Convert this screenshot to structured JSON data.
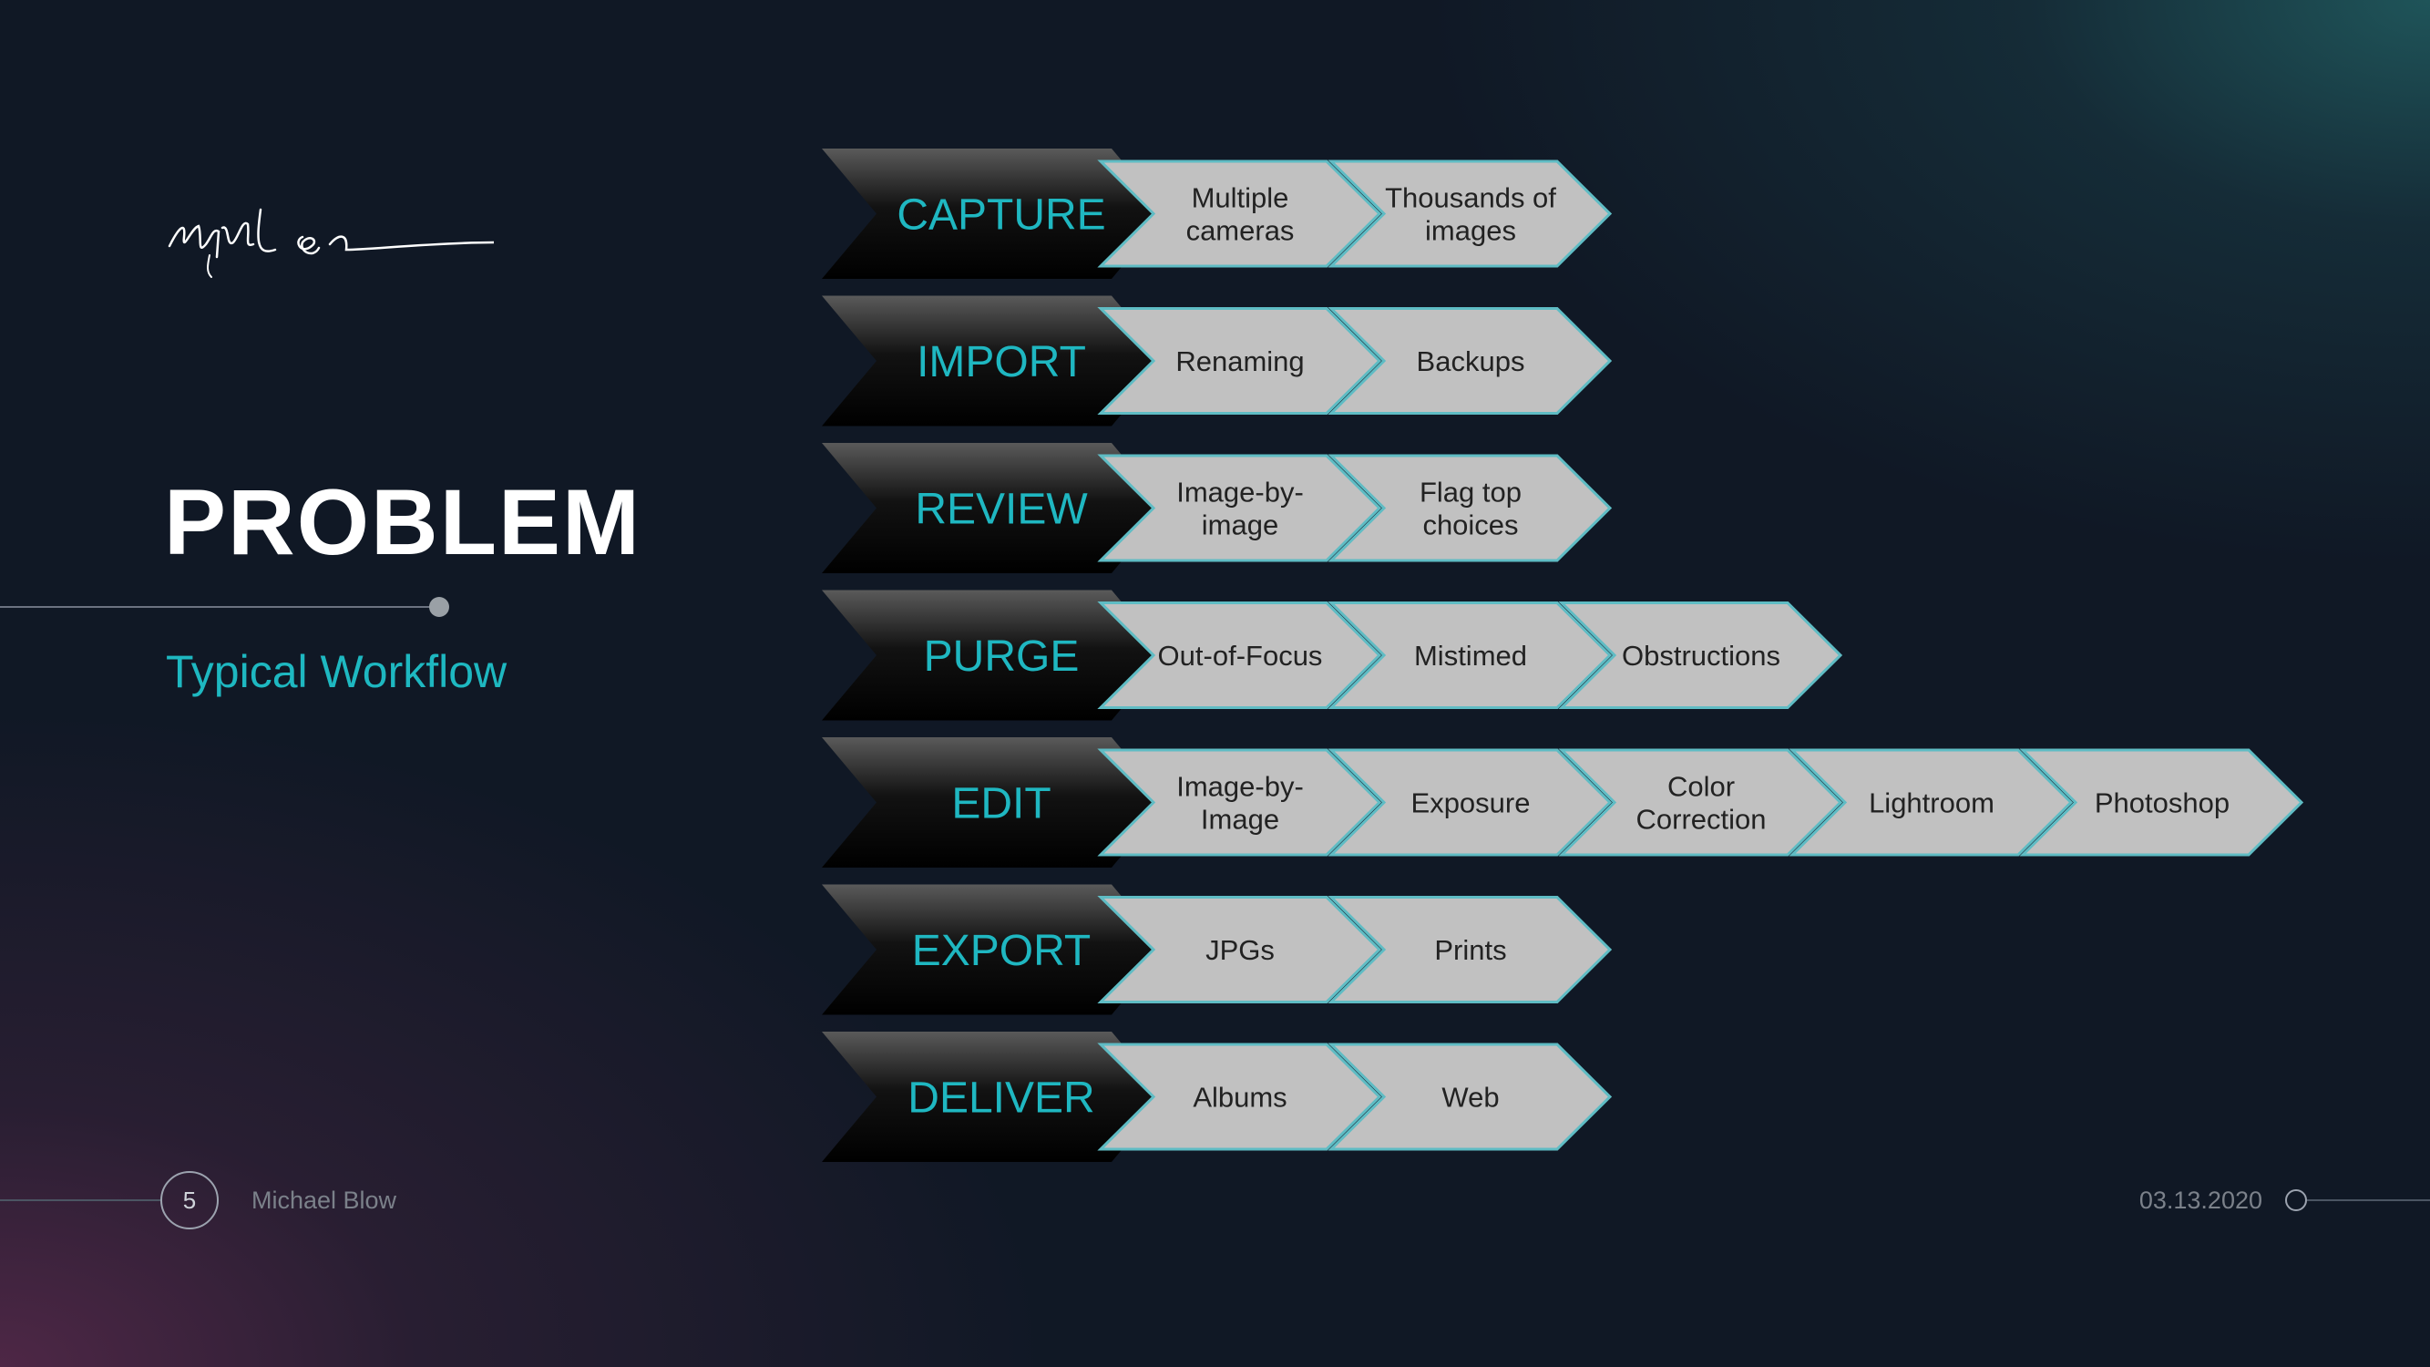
{
  "slide": {
    "title": "PROBLEM",
    "subtitle": "Typical Workflow",
    "page_number": "5",
    "presenter": "Michael Blow",
    "date": "03.13.2020"
  },
  "colors": {
    "accent": "#1fb7c1",
    "step_fill": "#c1c1c1",
    "step_outline": "#5fbcc4",
    "stage_fill": "#000000"
  },
  "workflow": [
    {
      "stage": "CAPTURE",
      "steps": [
        [
          "Multiple",
          "cameras"
        ],
        [
          "Thousands of",
          "images"
        ]
      ]
    },
    {
      "stage": "IMPORT",
      "steps": [
        [
          "Renaming"
        ],
        [
          "Backups"
        ]
      ]
    },
    {
      "stage": "REVIEW",
      "steps": [
        [
          "Image-by-",
          "image"
        ],
        [
          "Flag top",
          "choices"
        ]
      ]
    },
    {
      "stage": "PURGE",
      "steps": [
        [
          "Out-of-Focus"
        ],
        [
          "Mistimed"
        ],
        [
          "Obstructions"
        ]
      ]
    },
    {
      "stage": "EDIT",
      "steps": [
        [
          "Image-by-",
          "Image"
        ],
        [
          "Exposure"
        ],
        [
          "Color",
          "Correction"
        ],
        [
          "Lightroom"
        ],
        [
          "Photoshop"
        ]
      ]
    },
    {
      "stage": "EXPORT",
      "steps": [
        [
          "JPGs"
        ],
        [
          "Prints"
        ]
      ]
    },
    {
      "stage": "DELIVER",
      "steps": [
        [
          "Albums"
        ],
        [
          "Web"
        ]
      ]
    }
  ]
}
